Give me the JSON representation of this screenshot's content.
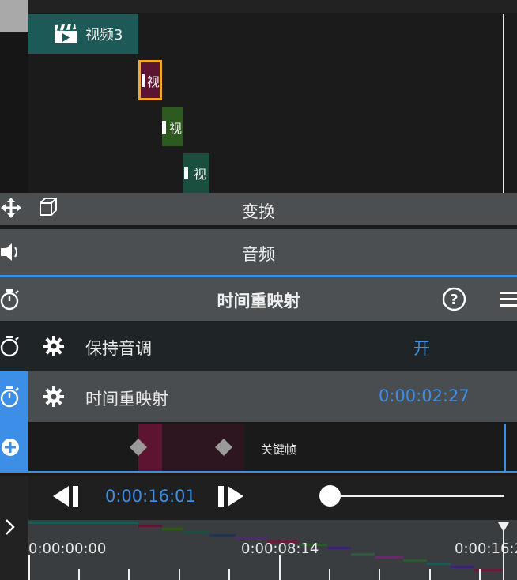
{
  "clips": {
    "video3_label": "视频3",
    "short_label": "视"
  },
  "panels": {
    "transform_label": "变换",
    "audio_label": "音频",
    "time_remap_header": "时间重映射",
    "keep_pitch_label": "保持音调",
    "keep_pitch_value": "开",
    "time_remap_label": "时间重映射",
    "time_remap_value": "0:00:02:27",
    "keyframe_label": "关键帧"
  },
  "transport": {
    "current_time": "0:00:16:01",
    "slider_level": 0
  },
  "ruler": {
    "labels": [
      "0:00:00:00",
      "0:00:08:14",
      "0:00:16:2"
    ]
  },
  "colors": {
    "accent": "#3d8ee6",
    "clip_teal": "#1d5a57",
    "clip_maroon": "#5c1430",
    "clip_green": "#2d5a1f",
    "clip_dark_teal": "#1a4f3f",
    "selected_border": "#f0a830"
  }
}
